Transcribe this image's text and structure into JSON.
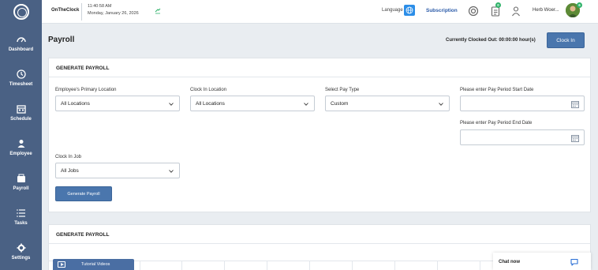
{
  "app": {
    "company": "OnTheClock",
    "time": "11:40:58 AM",
    "date": "Monday, January 26, 2026"
  },
  "sidebar": {
    "items": [
      {
        "label": "Dashboard",
        "icon": "dashboard-icon"
      },
      {
        "label": "Timesheet",
        "icon": "clock-icon"
      },
      {
        "label": "Schedule",
        "icon": "calendar-icon"
      },
      {
        "label": "Employee",
        "icon": "user-icon"
      },
      {
        "label": "Payroll",
        "icon": "wallet-icon"
      },
      {
        "label": "Tasks",
        "icon": "tasks-icon"
      },
      {
        "label": "Settings",
        "icon": "gear-icon"
      }
    ]
  },
  "topbar": {
    "language_label": "Language",
    "subscription": "Subscription",
    "notifications_badge": "0",
    "user_badge": "6",
    "username": "Herb Woer..."
  },
  "header": {
    "title": "Payroll",
    "status": "Currently Clocked Out: 00:00:00 hour(s)",
    "clock_in": "Clock In"
  },
  "form": {
    "title": "GENERATE PAYROLL",
    "primary_location_label": "Employee's Primary Location",
    "primary_location_value": "All Locations",
    "clockin_location_label": "Clock In Location",
    "clockin_location_value": "All Locations",
    "pay_type_label": "Select Pay Type",
    "pay_type_value": "Custom",
    "start_date_label": "Please enter Pay Period Start Date",
    "start_date_value": "",
    "end_date_label": "Please enter Pay Period End Date",
    "end_date_value": "",
    "job_label": "Clock In Job",
    "job_value": "All Jobs",
    "generate_button": "Generate Payroll"
  },
  "results": {
    "title": "GENERATE PAYROLL"
  },
  "tutorial": "Tutorial Videos",
  "chat": "Chat now",
  "colors": {
    "sidebar": "#4a6184",
    "primary_button": "#4a76ad",
    "badge": "#2fb36a",
    "link": "#2a5aa8"
  }
}
